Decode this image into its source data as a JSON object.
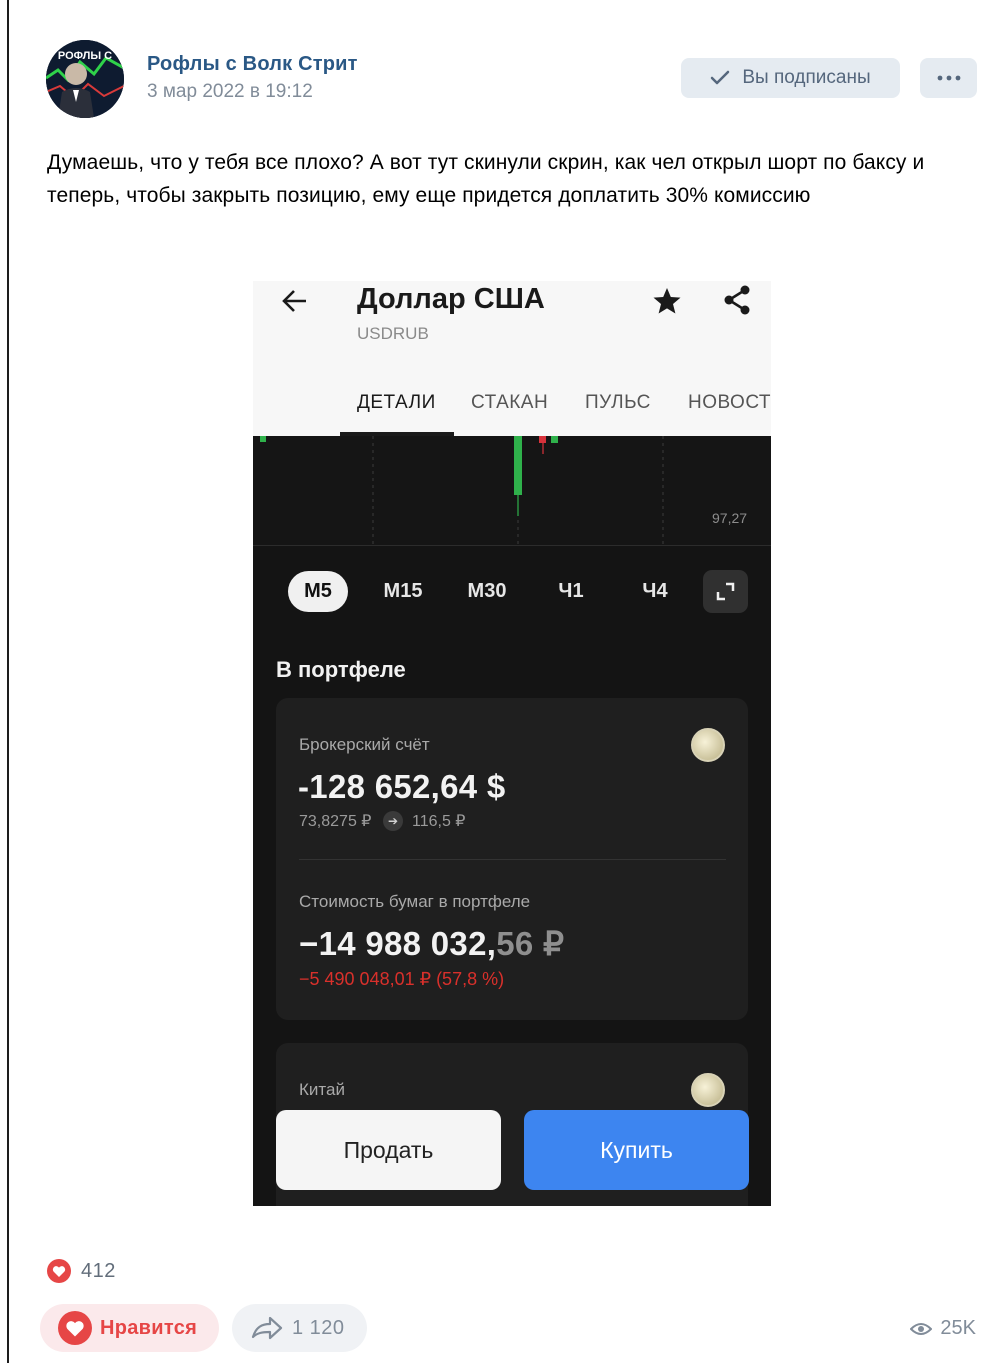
{
  "post": {
    "author": "Рофлы с Волк Стрит",
    "date": "3 мар 2022 в 19:12",
    "avatar_text": "РОФЛЫ С",
    "subscribed_label": "Вы подписаны",
    "text": "Думаешь, что у тебя все плохо? А вот тут скинули скрин, как чел открыл шорт по баксу и теперь, чтобы закрыть позицию, ему еще придется доплатить 30% комиссию"
  },
  "screenshot": {
    "title": "Доллар США",
    "ticker": "USDRUB",
    "tabs": [
      "ДЕТАЛИ",
      "СТАКАН",
      "ПУЛЬС",
      "НОВОСТИ"
    ],
    "active_tab": "ДЕТАЛИ",
    "chart_price_label": "97,27",
    "timeframes": [
      "M5",
      "M15",
      "M30",
      "Ч1",
      "Ч4"
    ],
    "active_timeframe": "M5",
    "portfolio_title": "В портфеле",
    "account": {
      "label": "Брокерский счёт",
      "amount": "-128 652,64 $",
      "from_rate": "73,8275 ₽",
      "to_rate": "116,5 ₽"
    },
    "value": {
      "label": "Стоимость бумаг в портфеле",
      "amount_main": "−14 988 032,",
      "amount_cents": "56 ₽",
      "change": "−5 490 048,01 ₽ (57,8 %)"
    },
    "next_item": "Китай",
    "sell_label": "Продать",
    "buy_label": "Купить",
    "colors": {
      "buy": "#3d85f0",
      "loss": "#d9302b",
      "candle_up": "#2fb14b",
      "candle_down": "#d8323b"
    }
  },
  "footer": {
    "likes_count": "412",
    "like_label": "Нравится",
    "shares_count": "1 120",
    "views_count": "25K"
  },
  "icons": [
    "check-icon",
    "more-icon",
    "back-arrow-icon",
    "star-icon",
    "share-icon",
    "expand-icon",
    "heart-icon",
    "share-arrow-icon",
    "eye-icon"
  ]
}
